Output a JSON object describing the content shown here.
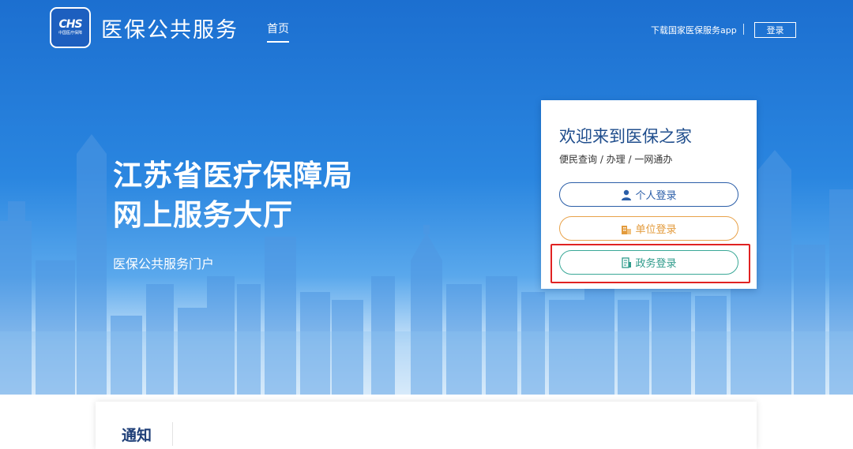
{
  "header": {
    "logo_text": "CHS",
    "logo_subtext": "中国医疗保障",
    "site_title": "医保公共服务",
    "nav": {
      "home": "首页"
    },
    "download_link": "下载国家医保服务app",
    "login_button": "登录"
  },
  "hero": {
    "title_line1": "江苏省医疗保障局",
    "title_line2": "网上服务大厅",
    "subtitle": "医保公共服务门户"
  },
  "login_card": {
    "title": "欢迎来到医保之家",
    "subtitle": "便民查询 / 办理 / 一网通办",
    "buttons": {
      "personal": "个人登录",
      "unit": "单位登录",
      "government": "政务登录"
    }
  },
  "notice": {
    "title": "通知"
  },
  "colors": {
    "brand_blue": "#1c6fd0",
    "personal": "#2b5ea8",
    "unit": "#e39b3c",
    "government": "#2f9b8b",
    "highlight": "#e02222"
  },
  "icons": [
    "user-icon",
    "building-icon",
    "document-icon"
  ]
}
